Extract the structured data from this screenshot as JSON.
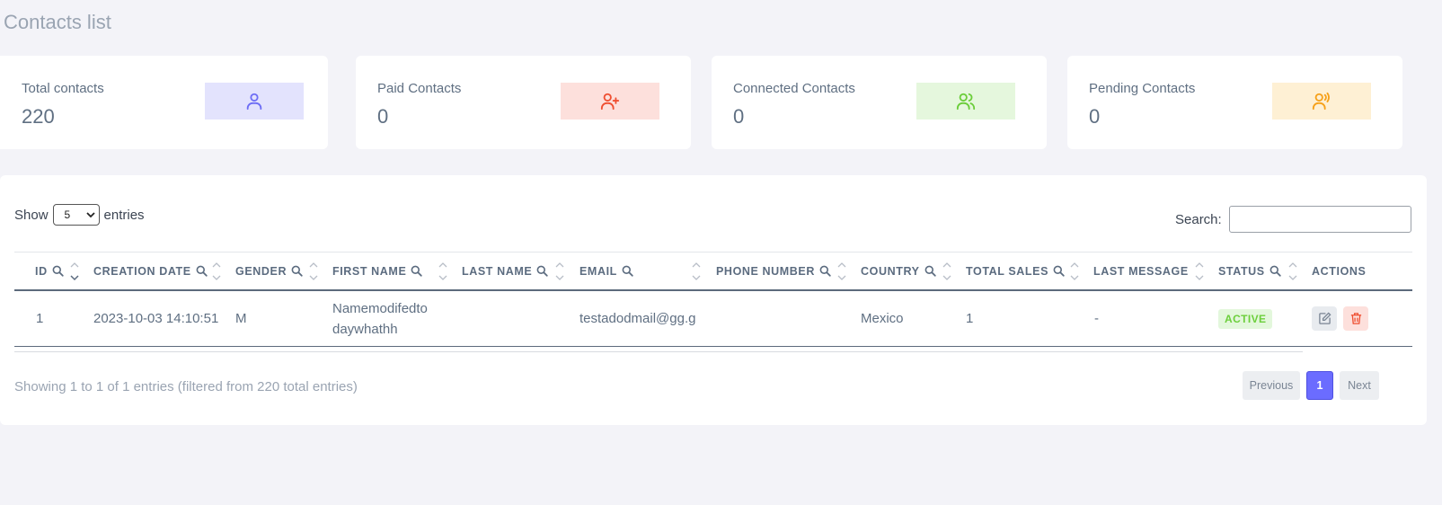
{
  "page": {
    "title": "Contacts list"
  },
  "stats": [
    {
      "label": "Total contacts",
      "value": "220",
      "icon": "user-icon",
      "bg": "#e3e3fd",
      "color": "#6e6ef5"
    },
    {
      "label": "Paid Contacts",
      "value": "0",
      "icon": "user-plus-icon",
      "bg": "#fde0dc",
      "color": "#ef4f31"
    },
    {
      "label": "Connected Contacts",
      "value": "0",
      "icon": "users-icon",
      "bg": "#e5f7dd",
      "color": "#6bcd3a"
    },
    {
      "label": "Pending Contacts",
      "value": "0",
      "icon": "user-signal-icon",
      "bg": "#fef0d4",
      "color": "#f6a11a"
    }
  ],
  "table_controls": {
    "show_label": "Show",
    "entries_value": "5",
    "entries_label": "entries",
    "search_label": "Search:",
    "search_value": ""
  },
  "columns": [
    "ID",
    "CREATION DATE",
    "GENDER",
    "FIRST NAME",
    "LAST NAME",
    "EMAIL",
    "PHONE NUMBER",
    "COUNTRY",
    "TOTAL SALES",
    "LAST MESSAGE",
    "STATUS",
    "ACTIONS"
  ],
  "rows": [
    {
      "id": "1",
      "creation_date": "2023-10-03 14:10:51",
      "gender": "M",
      "first_name_line1": "Namemodifedto",
      "first_name_line2": "daywhathh",
      "last_name": "",
      "email": "testadodmail@gg.g",
      "phone": "",
      "country": "Mexico",
      "total_sales": "1",
      "last_message": "-",
      "status": "ACTIVE"
    }
  ],
  "footer": {
    "info": "Showing 1 to 1 of 1 entries (filtered from 220 total entries)",
    "previous": "Previous",
    "page": "1",
    "next": "Next"
  },
  "colors": {
    "accent": "#6b6cff",
    "active_badge": "#6ccf3c",
    "delete": "#ef4f31"
  }
}
